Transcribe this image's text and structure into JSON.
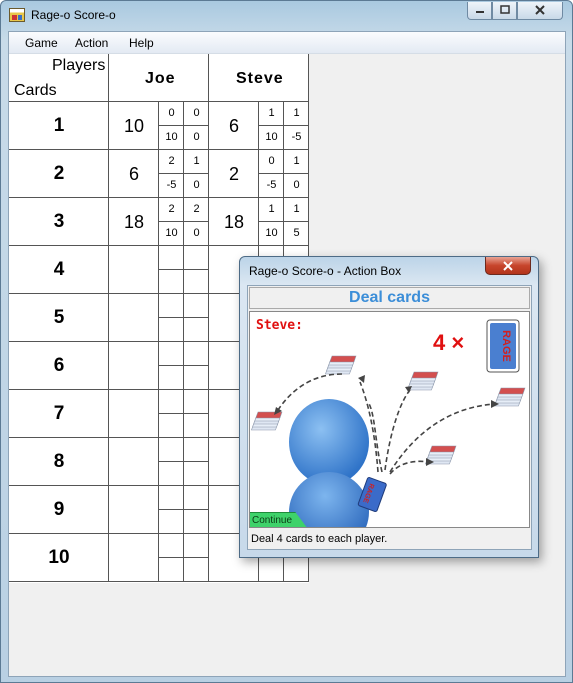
{
  "window": {
    "title": "Rage-o Score-o"
  },
  "menu": [
    "Game",
    "Action",
    "Help"
  ],
  "scoreboard": {
    "players_label": "Players",
    "cards_label": "Cards",
    "players": [
      "Joe",
      "Steve"
    ],
    "rounds": [
      {
        "cards": "1",
        "joe": {
          "total": "10",
          "bid": "0",
          "tricks": "0",
          "delta": "10",
          "bonus": "0"
        },
        "steve": {
          "total": "6",
          "bid": "1",
          "tricks": "1",
          "delta": "10",
          "bonus": "-5"
        }
      },
      {
        "cards": "2",
        "joe": {
          "total": "6",
          "bid": "2",
          "tricks": "1",
          "delta": "-5",
          "bonus": "0"
        },
        "steve": {
          "total": "2",
          "bid": "0",
          "tricks": "1",
          "delta": "-5",
          "bonus": "0"
        }
      },
      {
        "cards": "3",
        "joe": {
          "total": "18",
          "bid": "2",
          "tricks": "2",
          "delta": "10",
          "bonus": "0"
        },
        "steve": {
          "total": "18",
          "bid": "1",
          "tricks": "1",
          "delta": "10",
          "bonus": "5"
        }
      },
      {
        "cards": "4"
      },
      {
        "cards": "5"
      },
      {
        "cards": "6"
      },
      {
        "cards": "7"
      },
      {
        "cards": "8"
      },
      {
        "cards": "9"
      },
      {
        "cards": "10"
      }
    ]
  },
  "action_box": {
    "title": "Rage-o Score-o - Action Box",
    "heading": "Deal cards",
    "player": "Steve:",
    "count": "4 ×",
    "card_text": "RAGE",
    "continue": "Continue",
    "status": "Deal 4 cards to each player."
  }
}
